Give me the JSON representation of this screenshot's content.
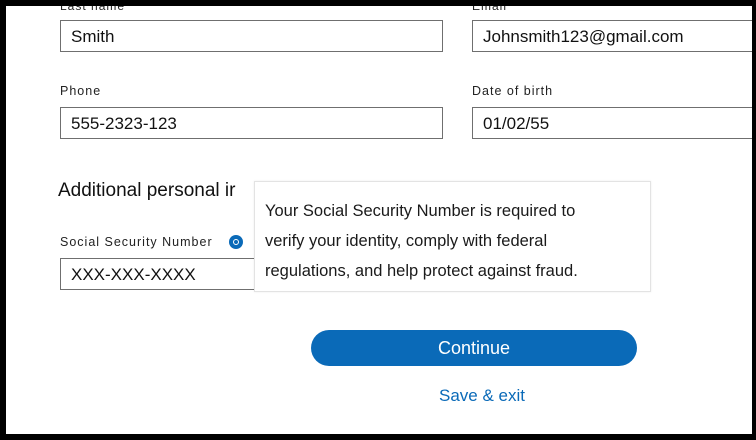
{
  "form": {
    "last_name_label": "Last name",
    "email_label": "Email",
    "last_name_value": "Smith",
    "email_value": "Johnsmith123@gmail.com",
    "phone_label": "Phone",
    "phone_value": "555-2323-123",
    "dob_label": "Date of birth",
    "dob_value": "01/02/55"
  },
  "additional": {
    "heading": "Additional personal ir",
    "ssn_label": "Social Security Number",
    "ssn_value": "XXX-XXX-XXXX",
    "info_icon": "info-icon"
  },
  "tooltip": {
    "line1": "Your Social Security Number is required to",
    "line2": "verify your identity, comply with federal",
    "line3": "regulations, and help protect against fraud."
  },
  "actions": {
    "continue_label": "Continue",
    "save_exit_label": "Save & exit"
  },
  "colors": {
    "accent": "#0a6ab8",
    "frame": "#000000"
  }
}
